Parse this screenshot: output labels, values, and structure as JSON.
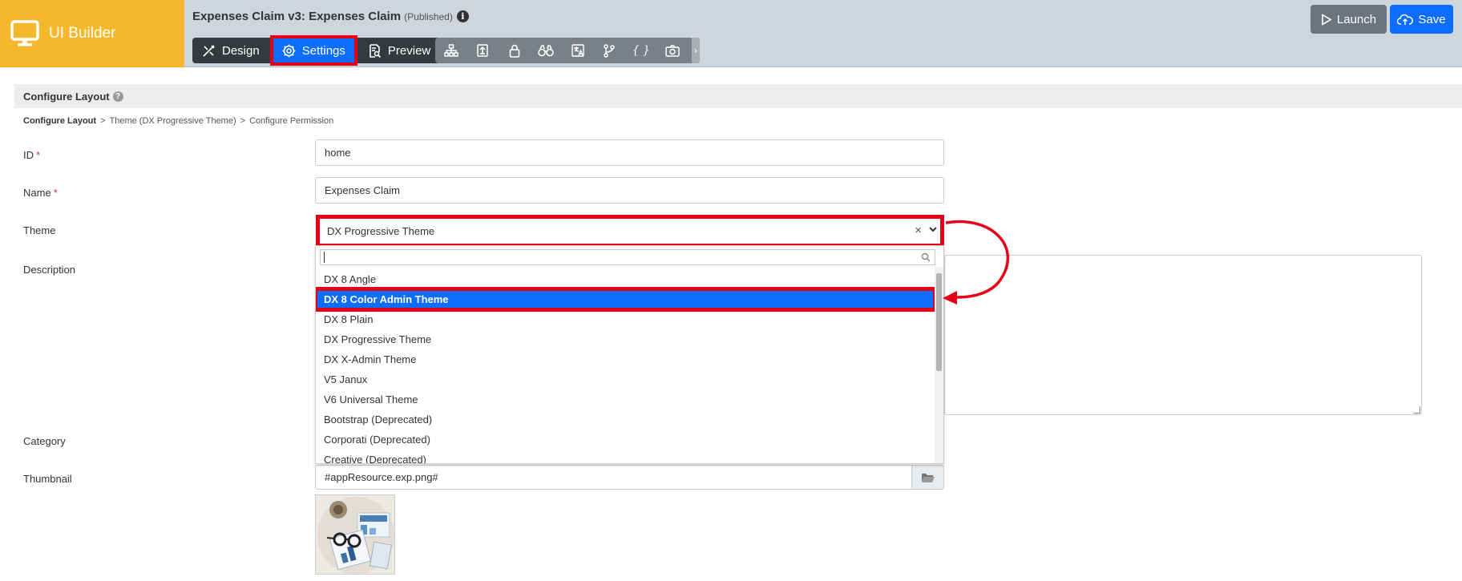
{
  "brand": {
    "name": "UI Builder",
    "color": "#f5b72b"
  },
  "header": {
    "title": "Expenses Claim v3: Expenses Claim",
    "status": "(Published)",
    "info_glyph": "i",
    "nav": [
      {
        "label": "Design",
        "icon": "design-tools-icon"
      },
      {
        "label": "Settings",
        "icon": "gear-icon",
        "active": true
      },
      {
        "label": "Preview",
        "icon": "preview-icon"
      }
    ],
    "tool_icons": [
      "sitemap-icon",
      "properties-icon",
      "lock-icon",
      "binoculars-icon",
      "translate-icon",
      "branch-icon",
      "json-icon",
      "camera-icon"
    ],
    "json_glyph": "{ }",
    "chevron_glyph": "›",
    "launch_label": "Launch",
    "save_label": "Save"
  },
  "section": {
    "title": "Configure Layout",
    "help_glyph": "?"
  },
  "breadcrumb": [
    "Configure Layout",
    "Theme (DX Progressive Theme)",
    "Configure Permission"
  ],
  "breadcrumb_sep": ">",
  "form": {
    "required_mark": "*",
    "id_label": "ID",
    "id_value": "home",
    "name_label": "Name",
    "name_value": "Expenses Claim",
    "theme_label": "Theme",
    "theme_value": "DX Progressive Theme",
    "clear_glyph": "×",
    "description_label": "Description",
    "category_label": "Category",
    "thumbnail_label": "Thumbnail",
    "thumbnail_value": "#appResource.exp.png#"
  },
  "dropdown": {
    "options": [
      "DX 8 Angle",
      "DX 8 Color Admin Theme",
      "DX 8 Plain",
      "DX Progressive Theme",
      "DX X-Admin Theme",
      "V5 Janux",
      "V6 Universal Theme",
      "Bootstrap (Deprecated)",
      "Corporati (Deprecated)",
      "Creative (Deprecated)"
    ],
    "highlighted_index": 1
  },
  "colors": {
    "accent": "#0d6efd",
    "annotation": "#e5001a",
    "header_bg": "#cfd5dc",
    "dark": "#343a40"
  }
}
